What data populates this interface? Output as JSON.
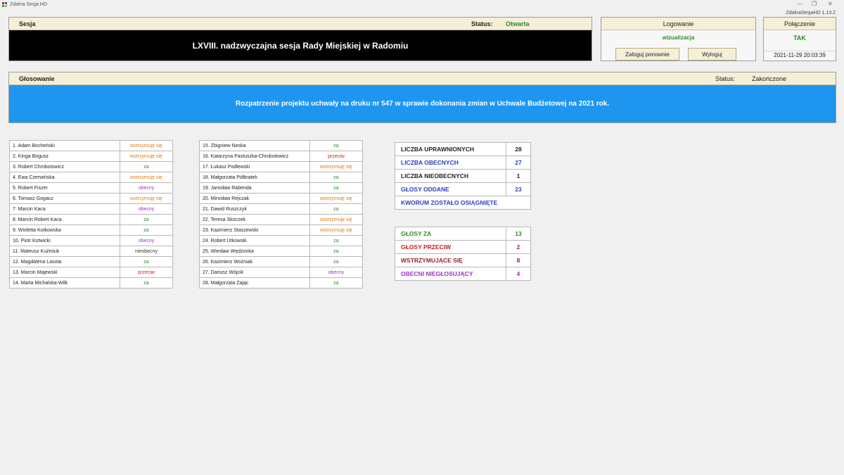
{
  "window": {
    "title": "Zdalna Sesja HD",
    "version": "ZdalnaSesjaHD 1.13.2"
  },
  "colors": {
    "za": "#2b8a2b",
    "wstrzymuje": "#e07a12",
    "przeciw": "#d01c1c",
    "obecny": "#a330c8",
    "session_bar": "#000000",
    "subject_bar": "#1e96f0",
    "header_bg": "#f5efd7"
  },
  "sesja": {
    "label": "Sesja",
    "status_label": "Status:",
    "status_value": "Otwarta",
    "name": "LXVIII. nadzwyczajna sesja Rady Miejskiej w Radomiu"
  },
  "logowanie": {
    "label": "Logowanie",
    "mode": "wizualizacja",
    "relogin_button": "Zaloguj ponownie",
    "logout_button": "Wyloguj"
  },
  "polaczenie": {
    "label": "Połączenie",
    "value": "TAK",
    "datetime": "2021-11-29 20:03:39"
  },
  "glosowanie": {
    "label": "Głosowanie",
    "status_label": "Status:",
    "status_value": "Zakończone",
    "subject": "Rozpatrzenie projektu uchwały na druku nr 547 w sprawie dokonania zmian w Uchwale Budżetowej na 2021 rok."
  },
  "votes_left": [
    {
      "name": "1. Adam Bocheński",
      "vote": "wstrzymuję się",
      "kind": "wstrz"
    },
    {
      "name": "2. Kinga Bogusz",
      "vote": "wstrzymuję się",
      "kind": "wstrz"
    },
    {
      "name": "3. Robert Chrobotowicz",
      "vote": "za",
      "kind": "za"
    },
    {
      "name": "4. Ewa Czerwińska",
      "vote": "wstrzymuję się",
      "kind": "wstrz"
    },
    {
      "name": "5. Robert Fiszer",
      "vote": "obecny",
      "kind": "obecny"
    },
    {
      "name": "6. Tomasz Gogacz",
      "vote": "wstrzymuję się",
      "kind": "wstrz"
    },
    {
      "name": "7. Marcin Kaca",
      "vote": "obecny",
      "kind": "obecny"
    },
    {
      "name": "8. Marcin Robert Kaca",
      "vote": "za",
      "kind": "za"
    },
    {
      "name": "9. Wioletta Kotkowska",
      "vote": "za",
      "kind": "za"
    },
    {
      "name": "10. Piotr Kotwicki",
      "vote": "obecny",
      "kind": "obecny"
    },
    {
      "name": "11. Mateusz Kuźmiuk",
      "vote": "nieobecny",
      "kind": "nieobecny"
    },
    {
      "name": "12. Magdalena Lasota",
      "vote": "za",
      "kind": "za"
    },
    {
      "name": "13. Marcin Majewski",
      "vote": "przeciw",
      "kind": "przeciw"
    },
    {
      "name": "14. Marta Michalska-Wilk",
      "vote": "za",
      "kind": "za"
    }
  ],
  "votes_right": [
    {
      "name": "15. Zbigniew Neska",
      "vote": "za",
      "kind": "za"
    },
    {
      "name": "16. Katarzyna Pastuszka-Chrobotowicz",
      "vote": "przeciw",
      "kind": "przeciw"
    },
    {
      "name": "17. Łukasz Podlewski",
      "vote": "wstrzymuję się",
      "kind": "wstrz"
    },
    {
      "name": "18. Małgorzata Półbratek",
      "vote": "za",
      "kind": "za"
    },
    {
      "name": "19. Jarosław Rabenda",
      "vote": "za",
      "kind": "za"
    },
    {
      "name": "20. Mirosław Rejczak",
      "vote": "wstrzymuję się",
      "kind": "wstrz"
    },
    {
      "name": "21. Dawid Ruszczyk",
      "vote": "za",
      "kind": "za"
    },
    {
      "name": "22. Teresa Skoczek",
      "vote": "wstrzymuję się",
      "kind": "wstrz"
    },
    {
      "name": "23. Kazimierz Staszewski",
      "vote": "wstrzymuję się",
      "kind": "wstrz"
    },
    {
      "name": "24. Robert Utkowski",
      "vote": "za",
      "kind": "za"
    },
    {
      "name": "25. Wiesław Wędzonka",
      "vote": "za",
      "kind": "za"
    },
    {
      "name": "26. Kazimierz Woźniak",
      "vote": "za",
      "kind": "za"
    },
    {
      "name": "27. Dariusz Wójcik",
      "vote": "obecny",
      "kind": "obecny"
    },
    {
      "name": "28. Małgorzata Zając",
      "vote": "za",
      "kind": "za"
    }
  ],
  "stats": {
    "uprawnionych_label": "LICZBA UPRAWNIONYCH",
    "uprawnionych": "28",
    "obecnych_label": "LICZBA OBECNYCH",
    "obecnych": "27",
    "nieobecnych_label": "LICZBA NIEOBECNYCH",
    "nieobecnych": "1",
    "oddane_label": "GŁOSY ODDANE",
    "oddane": "23",
    "kworum": "KWORUM ZOSTAŁO OSIĄGNIĘTE"
  },
  "results": {
    "za_label": "GŁOSY ZA",
    "za": "13",
    "przeciw_label": "GŁOSY PRZECIW",
    "przeciw": "2",
    "wstrzymujace_label": "WSTRZYMUJĄCE SIĘ",
    "wstrzymujace": "8",
    "nieglosujacy_label": "OBECNI NIEGŁOSUJĄCY",
    "nieglosujacy": "4"
  }
}
